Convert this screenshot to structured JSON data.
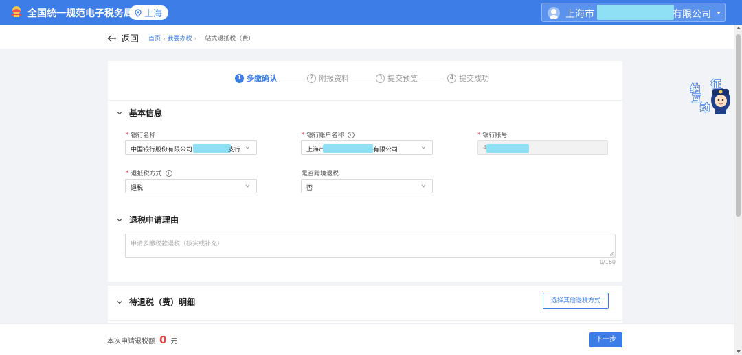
{
  "header": {
    "brand": "全国统一规范电子税务局",
    "region": "上海",
    "company_prefix": "上海市",
    "company_suffix": "有限公司"
  },
  "breadcrumb": {
    "back": "返回",
    "items": [
      "首页",
      "我要办税",
      "一站式退抵税（费）"
    ]
  },
  "steps": [
    {
      "num": "1",
      "label": "多缴确认"
    },
    {
      "num": "2",
      "label": "附报资料"
    },
    {
      "num": "3",
      "label": "提交预览"
    },
    {
      "num": "4",
      "label": "提交成功"
    }
  ],
  "basic_info": {
    "title": "基本信息",
    "bank_name": {
      "label": "银行名称",
      "prefix": "中国银行股份有限公司",
      "suffix": "支行"
    },
    "account_name": {
      "label": "银行账户名称",
      "prefix": "上海市",
      "suffix": "有限公司"
    },
    "account_number": {
      "label": "银行账号",
      "prefix": "4"
    },
    "refund_method": {
      "label": "退抵税方式",
      "value": "退税"
    },
    "cross_border": {
      "label": "是否跨境退税",
      "value": "否"
    }
  },
  "reason": {
    "title": "退税申请理由",
    "placeholder": "申请多缴税款退税（核实或补充）",
    "counter": "0/160"
  },
  "details": {
    "title": "待退税（费）明细",
    "other_button": "选择其他退税方式"
  },
  "mascot": {
    "chars": [
      "征",
      "纳",
      "互",
      "动"
    ]
  },
  "footer": {
    "amount_label": "本次申请退税额",
    "amount_value": "0",
    "amount_unit": "元",
    "next_button": "下一步"
  },
  "colors": {
    "primary": "#3d7de8",
    "required": "#e54545",
    "redaction": "#8fe0f4"
  }
}
